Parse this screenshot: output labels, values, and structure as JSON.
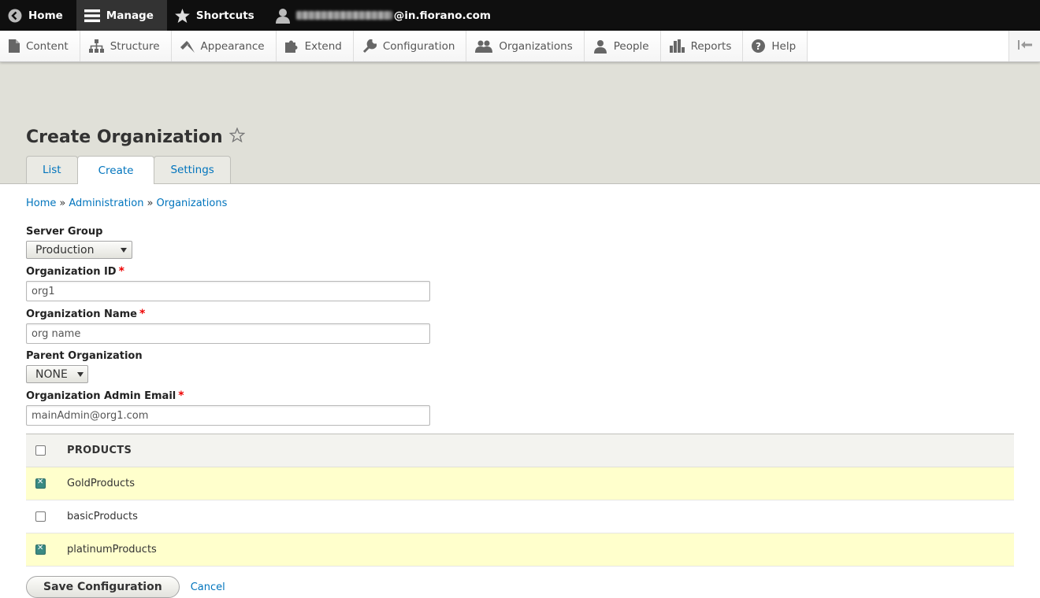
{
  "topbar": {
    "home_label": "Home",
    "manage_label": "Manage",
    "shortcuts_label": "Shortcuts",
    "user_email_suffix": "@in.fiorano.com"
  },
  "tray": {
    "items": [
      {
        "label": "Content",
        "icon": "file-icon"
      },
      {
        "label": "Structure",
        "icon": "sitemap-icon"
      },
      {
        "label": "Appearance",
        "icon": "paintbrush-icon"
      },
      {
        "label": "Extend",
        "icon": "puzzle-icon"
      },
      {
        "label": "Configuration",
        "icon": "wrench-icon"
      },
      {
        "label": "Organizations",
        "icon": "users-icon"
      },
      {
        "label": "People",
        "icon": "user-icon"
      },
      {
        "label": "Reports",
        "icon": "bar-chart-icon"
      },
      {
        "label": "Help",
        "icon": "help-icon"
      }
    ]
  },
  "page": {
    "title": "Create Organization",
    "tabs": [
      {
        "label": "List",
        "active": false
      },
      {
        "label": "Create",
        "active": true
      },
      {
        "label": "Settings",
        "active": false
      }
    ]
  },
  "breadcrumb": {
    "items": [
      "Home",
      "Administration",
      "Organizations"
    ],
    "separator": "»"
  },
  "form": {
    "server_group": {
      "label": "Server Group",
      "value": "Production"
    },
    "org_id": {
      "label": "Organization ID",
      "value": "org1",
      "required_mark": "*"
    },
    "org_name": {
      "label": "Organization Name",
      "value": "org name",
      "required_mark": "*"
    },
    "parent_org": {
      "label": "Parent Organization",
      "value": "NONE"
    },
    "admin_email": {
      "label": "Organization Admin Email",
      "value": "mainAdmin@org1.com",
      "required_mark": "*"
    }
  },
  "products_table": {
    "header": "PRODUCTS",
    "rows": [
      {
        "label": "GoldProducts",
        "checked": true
      },
      {
        "label": "basicProducts",
        "checked": false
      },
      {
        "label": "platinumProducts",
        "checked": true
      }
    ]
  },
  "actions": {
    "save_label": "Save Configuration",
    "cancel_label": "Cancel"
  },
  "colors": {
    "link": "#0074bd",
    "selected_row": "#ffffcc",
    "required": "#ee0000",
    "toolbar_bg": "#0f0f0f"
  }
}
